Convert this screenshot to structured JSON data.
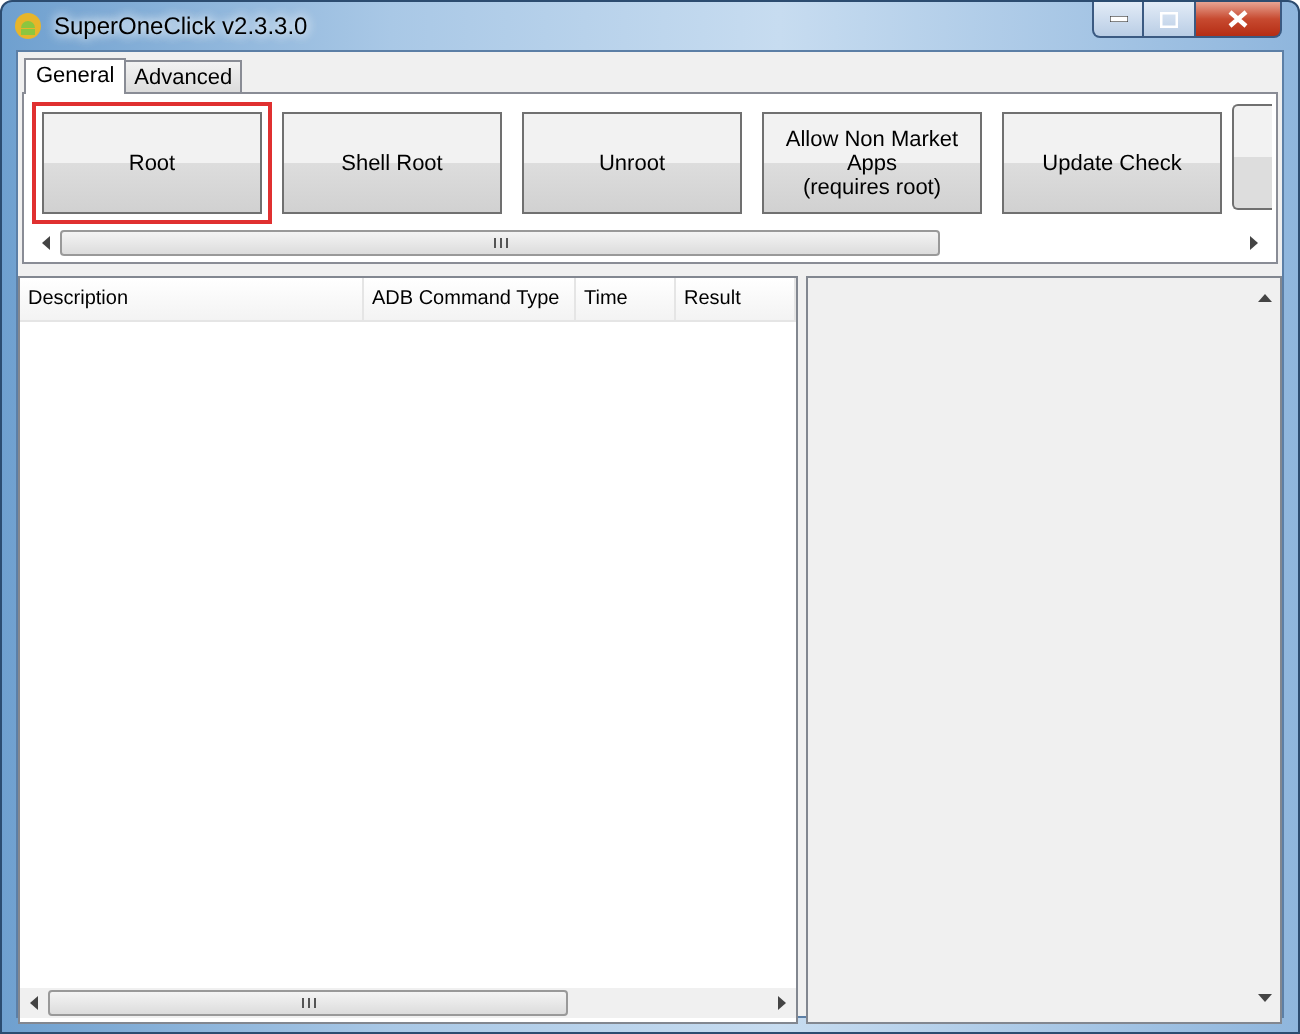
{
  "window": {
    "title": "SuperOneClick v2.3.3.0"
  },
  "tabs": [
    {
      "label": "General",
      "selected": true
    },
    {
      "label": "Advanced",
      "selected": false
    }
  ],
  "buttons": [
    {
      "label": "Root",
      "selected": true
    },
    {
      "label": "Shell Root",
      "selected": false
    },
    {
      "label": "Unroot",
      "selected": false
    },
    {
      "label": "Allow Non Market Apps\n(requires root)",
      "selected": false
    },
    {
      "label": "Update Check",
      "selected": false
    }
  ],
  "table": {
    "columns": [
      "Description",
      "ADB Command Type",
      "Time",
      "Result"
    ]
  }
}
